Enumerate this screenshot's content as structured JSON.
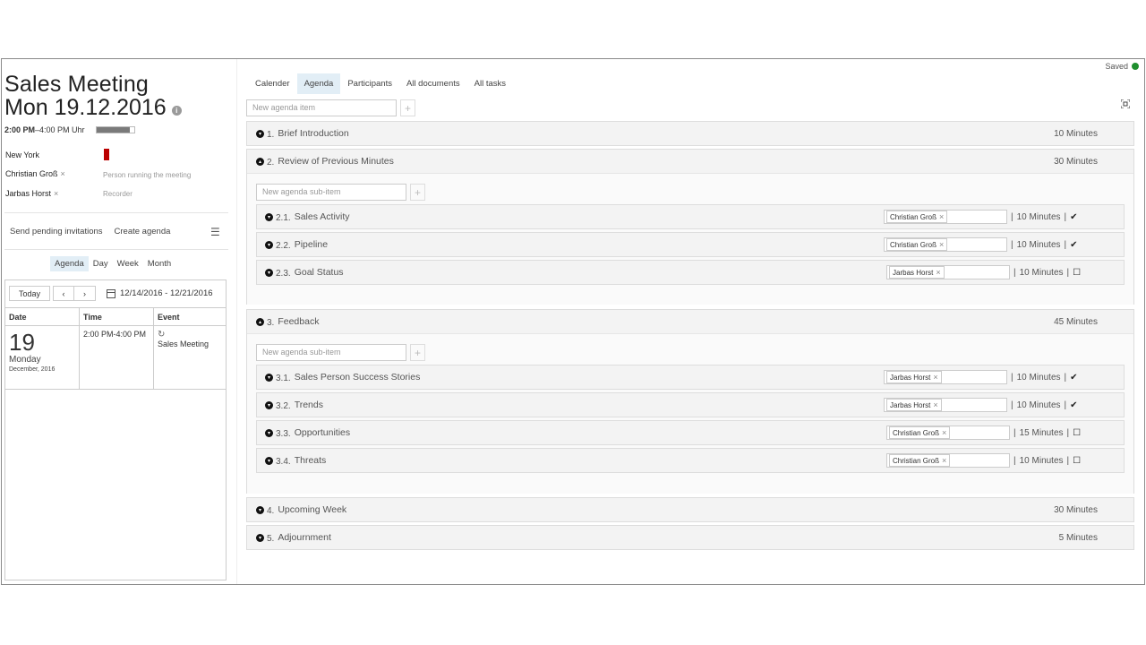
{
  "status": {
    "saved": "Saved"
  },
  "meeting": {
    "title": "Sales Meeting",
    "date": "Mon 19.12.2016",
    "time_bold": "2:00 PM",
    "time_rest": "–4:00 PM Uhr",
    "location": "New York",
    "people": [
      {
        "name": "Christian Groß",
        "role": "Person running the meeting"
      },
      {
        "name": "Jarbas Horst",
        "role": "Recorder"
      }
    ]
  },
  "actions": {
    "send": "Send pending invitations",
    "create": "Create agenda"
  },
  "calendar": {
    "views": [
      "Agenda",
      "Day",
      "Week",
      "Month"
    ],
    "today": "Today",
    "prev": "‹",
    "next": "›",
    "range": "12/14/2016 - 12/21/2016",
    "headers": [
      "Date",
      "Time",
      "Event"
    ],
    "entry": {
      "day": "19",
      "weekday": "Monday",
      "month": "December, 2016",
      "time": "2:00 PM-4:00 PM",
      "event": "Sales Meeting"
    }
  },
  "tabs": [
    "Calender",
    "Agenda",
    "Participants",
    "All documents",
    "All tasks"
  ],
  "agenda": {
    "new_item_placeholder": "New agenda item",
    "new_sub_placeholder": "New agenda sub-item",
    "items": [
      {
        "num": "1.",
        "title": "Brief Introduction",
        "minutes": "10 Minutes"
      },
      {
        "num": "2.",
        "title": "Review of Previous Minutes",
        "minutes": "30 Minutes",
        "subs": [
          {
            "num": "2.1.",
            "title": "Sales Activity",
            "person": "Christian Groß",
            "minutes": "10 Minutes",
            "status": "done"
          },
          {
            "num": "2.2.",
            "title": "Pipeline",
            "person": "Christian Groß",
            "minutes": "10 Minutes",
            "status": "done"
          },
          {
            "num": "2.3.",
            "title": "Goal Status",
            "person": "Jarbas Horst",
            "minutes": "10 Minutes",
            "status": "open"
          }
        ]
      },
      {
        "num": "3.",
        "title": "Feedback",
        "minutes": "45 Minutes",
        "subs": [
          {
            "num": "3.1.",
            "title": "Sales Person Success Stories",
            "person": "Jarbas Horst",
            "minutes": "10 Minutes",
            "status": "done"
          },
          {
            "num": "3.2.",
            "title": "Trends",
            "person": "Jarbas Horst",
            "minutes": "10 Minutes",
            "status": "done"
          },
          {
            "num": "3.3.",
            "title": "Opportunities",
            "person": "Christian Groß",
            "minutes": "15 Minutes",
            "status": "open"
          },
          {
            "num": "3.4.",
            "title": "Threats",
            "person": "Christian Groß",
            "minutes": "10 Minutes",
            "status": "open"
          }
        ]
      },
      {
        "num": "4.",
        "title": "Upcoming Week",
        "minutes": "30 Minutes"
      },
      {
        "num": "5.",
        "title": "Adjournment",
        "minutes": "5 Minutes"
      }
    ]
  },
  "icons": {
    "chevron-down": "▾",
    "chevron-up": "▴",
    "check": "✔",
    "bookmark": "☐",
    "remove": "×",
    "plus": "+",
    "info": "i",
    "menu": "☰",
    "refresh": "↻"
  }
}
